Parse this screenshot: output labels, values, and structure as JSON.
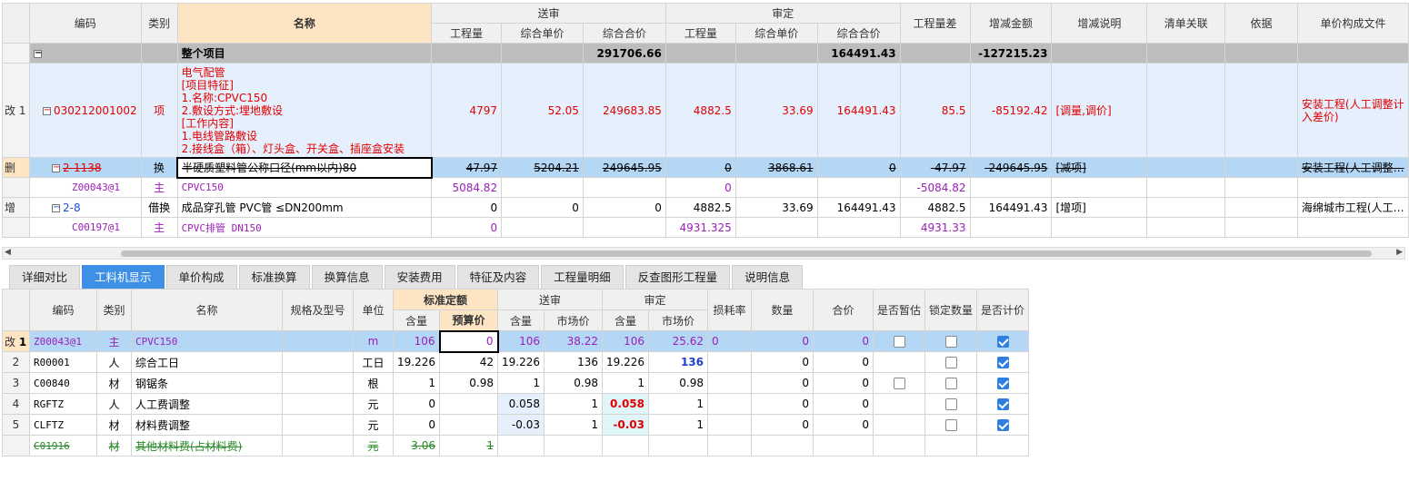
{
  "top": {
    "headers": {
      "code": "编码",
      "type": "类别",
      "name": "名称",
      "sent": "送审",
      "audit": "审定",
      "qty": "工程量",
      "uprice": "综合单价",
      "total": "综合合价",
      "qty_diff": "工程量差",
      "delta": "增减金额",
      "desc": "增减说明",
      "link": "清单关联",
      "basis": "依据",
      "file": "单价构成文件"
    },
    "group": {
      "name": "整个项目",
      "sent_total": "291706.66",
      "audit_total": "164491.43",
      "delta": "-127215.23"
    },
    "row1": {
      "mark": "改",
      "idx": "1",
      "code": "030212001002",
      "type": "项",
      "name_lines": [
        "电气配管",
        "[项目特征]",
        "1.名称:CPVC150",
        "2.敷设方式:埋地敷设",
        "[工作内容]",
        "1.电线管路敷设",
        "2.接线盒（箱）、灯头盒、开关盒、插座盒安装"
      ],
      "sent_qty": "4797",
      "sent_up": "52.05",
      "sent_total": "249683.85",
      "aud_qty": "4882.5",
      "aud_up": "33.69",
      "aud_total": "164491.43",
      "qty_diff": "85.5",
      "delta": "-85192.42",
      "desc": "[调量,调价]",
      "file": "安装工程(人工调整计入差价)"
    },
    "row2": {
      "mark": "删",
      "code": "2-1138",
      "type": "换",
      "name": "半硬质塑料管公称口径(mm以内)80",
      "sent_qty": "47.97",
      "sent_up": "5204.21",
      "sent_total": "249645.95",
      "aud_qty": "0",
      "aud_up": "3868.61",
      "aud_total": "0",
      "qty_diff": "-47.97",
      "delta": "-249645.95",
      "desc": "[减项]",
      "file": "安装工程(人工调整…"
    },
    "row3": {
      "code": "Z00043@1",
      "type": "主",
      "name": "CPVC150",
      "sent_qty": "5084.82",
      "aud_qty": "0",
      "qty_diff": "-5084.82"
    },
    "row4": {
      "mark": "增",
      "code": "2-8",
      "type": "借换",
      "name": "成品穿孔管 PVC管 ≤DN200mm",
      "sent_qty": "0",
      "sent_up": "0",
      "sent_total": "0",
      "aud_qty": "4882.5",
      "aud_up": "33.69",
      "aud_total": "164491.43",
      "qty_diff": "4882.5",
      "delta": "164491.43",
      "desc": "[增项]",
      "file": "海绵城市工程(人工…"
    },
    "row5": {
      "code": "C00197@1",
      "type": "主",
      "name": "CPVC排管 DN150",
      "sent_qty": "0",
      "aud_qty": "4931.325",
      "qty_diff": "4931.33"
    }
  },
  "tabs": [
    "详细对比",
    "工料机显示",
    "单价构成",
    "标准换算",
    "换算信息",
    "安装费用",
    "特征及内容",
    "工程量明细",
    "反查图形工程量",
    "说明信息"
  ],
  "active_tab": "工料机显示",
  "bottom": {
    "headers": {
      "code": "编码",
      "type": "类别",
      "name": "名称",
      "spec": "规格及型号",
      "unit": "单位",
      "std": "标准定额",
      "sent": "送审",
      "audit": "审定",
      "qty": "含量",
      "budget": "预算价",
      "market": "市场价",
      "loss": "损耗率",
      "count": "数量",
      "price": "合价",
      "est": "是否暂估",
      "lock": "锁定数量",
      "calc": "是否计价"
    },
    "rows": [
      {
        "mark": "改",
        "idx": "1",
        "code": "Z00043@1",
        "type": "主",
        "name": "CPVC150",
        "unit": "m",
        "std_qty": "106",
        "budget": "0",
        "sent_qty": "106",
        "sent_mkt": "38.22",
        "aud_qty": "106",
        "aud_mkt": "25.62",
        "loss": "0",
        "count": "0",
        "price": "0"
      },
      {
        "idx": "2",
        "code": "R00001",
        "type": "人",
        "name": "综合工日",
        "unit": "工日",
        "std_qty": "19.226",
        "budget": "42",
        "sent_qty": "19.226",
        "sent_mkt": "136",
        "aud_qty": "19.226",
        "aud_mkt": "136",
        "count": "0",
        "price": "0"
      },
      {
        "idx": "3",
        "code": "C00840",
        "type": "材",
        "name": "钢锯条",
        "unit": "根",
        "std_qty": "1",
        "budget": "0.98",
        "sent_qty": "1",
        "sent_mkt": "0.98",
        "aud_qty": "1",
        "aud_mkt": "0.98",
        "count": "0",
        "price": "0"
      },
      {
        "idx": "4",
        "code": "RGFTZ",
        "type": "人",
        "name": "人工费调整",
        "unit": "元",
        "std_qty": "0",
        "budget": "",
        "sent_qty": "0.058",
        "sent_mkt": "1",
        "aud_qty": "0.058",
        "aud_mkt": "1",
        "count": "0",
        "price": "0"
      },
      {
        "idx": "5",
        "code": "CLFTZ",
        "type": "材",
        "name": "材料费调整",
        "unit": "元",
        "std_qty": "0",
        "budget": "",
        "sent_qty": "-0.03",
        "sent_mkt": "1",
        "aud_qty": "-0.03",
        "aud_mkt": "1",
        "count": "0",
        "price": "0"
      },
      {
        "idx": "",
        "code": "C01916",
        "type": "材",
        "name": "其他材料费(占材料费)",
        "unit": "元",
        "std_qty": "3.06",
        "budget": "1"
      }
    ]
  }
}
